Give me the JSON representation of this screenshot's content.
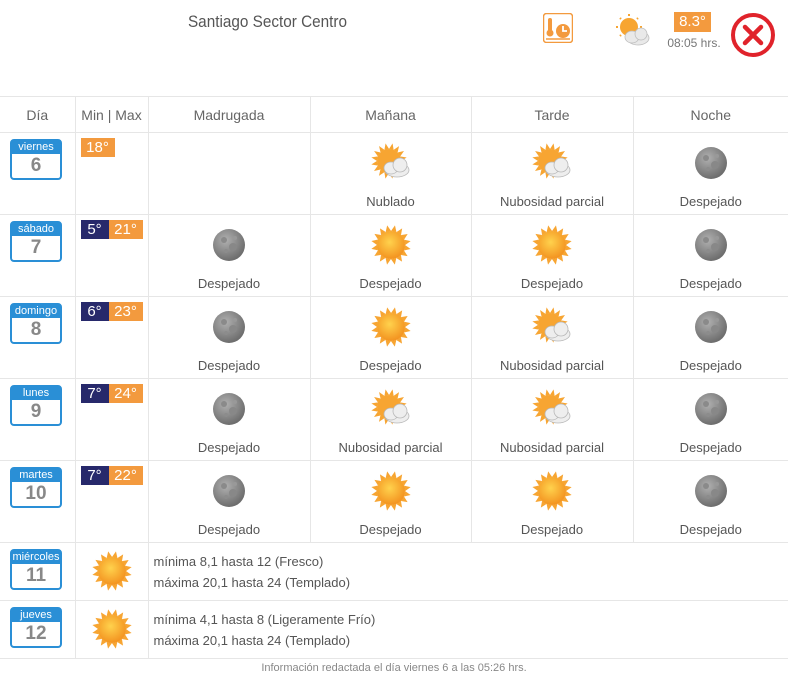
{
  "header": {
    "title": "Santiago Sector Centro",
    "current_temp": "8.3°",
    "current_time": "08:05 hrs.",
    "current_condition_icon": "sun-cloud-icon",
    "temp-time-icon": "thermometer-clock-icon",
    "close_icon": "close-icon"
  },
  "columns": [
    "Día",
    "Min | Max",
    "Madrugada",
    "Mañana",
    "Tarde",
    "Noche"
  ],
  "days": [
    {
      "dayname": "viernes",
      "num": "6",
      "min": "",
      "max": "18°",
      "slots": [
        {
          "icon": "",
          "label": ""
        },
        {
          "icon": "cloud",
          "label": "Nublado"
        },
        {
          "icon": "partly",
          "label": "Nubosidad parcial"
        },
        {
          "icon": "moon",
          "label": "Despejado"
        }
      ]
    },
    {
      "dayname": "sábado",
      "num": "7",
      "min": "5°",
      "max": "21°",
      "slots": [
        {
          "icon": "moon",
          "label": "Despejado"
        },
        {
          "icon": "sun",
          "label": "Despejado"
        },
        {
          "icon": "sun",
          "label": "Despejado"
        },
        {
          "icon": "moon",
          "label": "Despejado"
        }
      ]
    },
    {
      "dayname": "domingo",
      "num": "8",
      "min": "6°",
      "max": "23°",
      "slots": [
        {
          "icon": "moon",
          "label": "Despejado"
        },
        {
          "icon": "sun",
          "label": "Despejado"
        },
        {
          "icon": "partly",
          "label": "Nubosidad parcial"
        },
        {
          "icon": "moon",
          "label": "Despejado"
        }
      ]
    },
    {
      "dayname": "lunes",
      "num": "9",
      "min": "7°",
      "max": "24°",
      "slots": [
        {
          "icon": "moon",
          "label": "Despejado"
        },
        {
          "icon": "partly",
          "label": "Nubosidad parcial"
        },
        {
          "icon": "partly",
          "label": "Nubosidad parcial"
        },
        {
          "icon": "moon",
          "label": "Despejado"
        }
      ]
    },
    {
      "dayname": "martes",
      "num": "10",
      "min": "7°",
      "max": "22°",
      "slots": [
        {
          "icon": "moon",
          "label": "Despejado"
        },
        {
          "icon": "sun",
          "label": "Despejado"
        },
        {
          "icon": "sun",
          "label": "Despejado"
        },
        {
          "icon": "moon",
          "label": "Despejado"
        }
      ]
    }
  ],
  "extended": [
    {
      "dayname": "miércoles",
      "num": "11",
      "icon": "sun",
      "min_text": "mínima 8,1 hasta 12 (Fresco)",
      "max_text": "máxima 20,1 hasta 24 (Templado)"
    },
    {
      "dayname": "jueves",
      "num": "12",
      "icon": "sun",
      "min_text": "mínima 4,1 hasta 8 (Ligeramente Frío)",
      "max_text": "máxima 20,1 hasta 24 (Templado)"
    }
  ],
  "footer": "Información redactada el día viernes 6 a las 05:26 hrs.",
  "colors": {
    "accent_orange": "#f39a3e",
    "calendar_blue": "#2a8fd6",
    "min_navy": "#27296b",
    "close_red": "#e0232b"
  }
}
